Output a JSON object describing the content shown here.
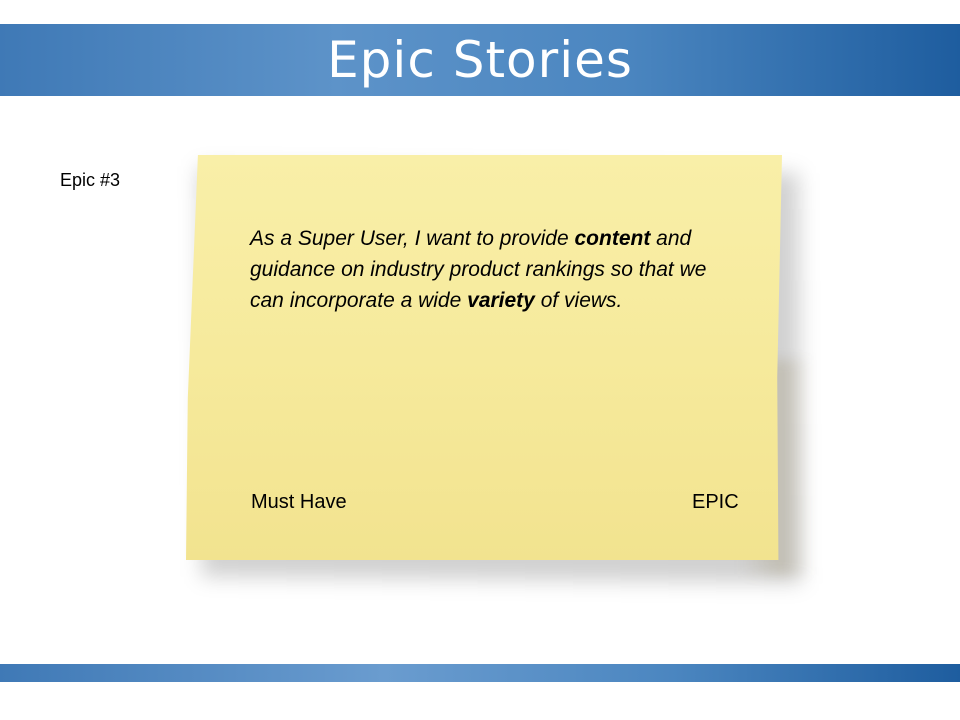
{
  "header": {
    "title": "Epic Stories"
  },
  "epic_number": "Epic #3",
  "card": {
    "story_part1": "As a Super User, I want to provide ",
    "story_bold1": "content",
    "story_part2": " and guidance on industry product rankings so that we can incorporate a wide ",
    "story_bold2": "variety",
    "story_part3": " of views.",
    "priority": "Must Have",
    "type": "EPIC"
  },
  "colors": {
    "header_bar": "#4b86c0",
    "note_background": "#f6ea9c",
    "text": "#000000"
  }
}
